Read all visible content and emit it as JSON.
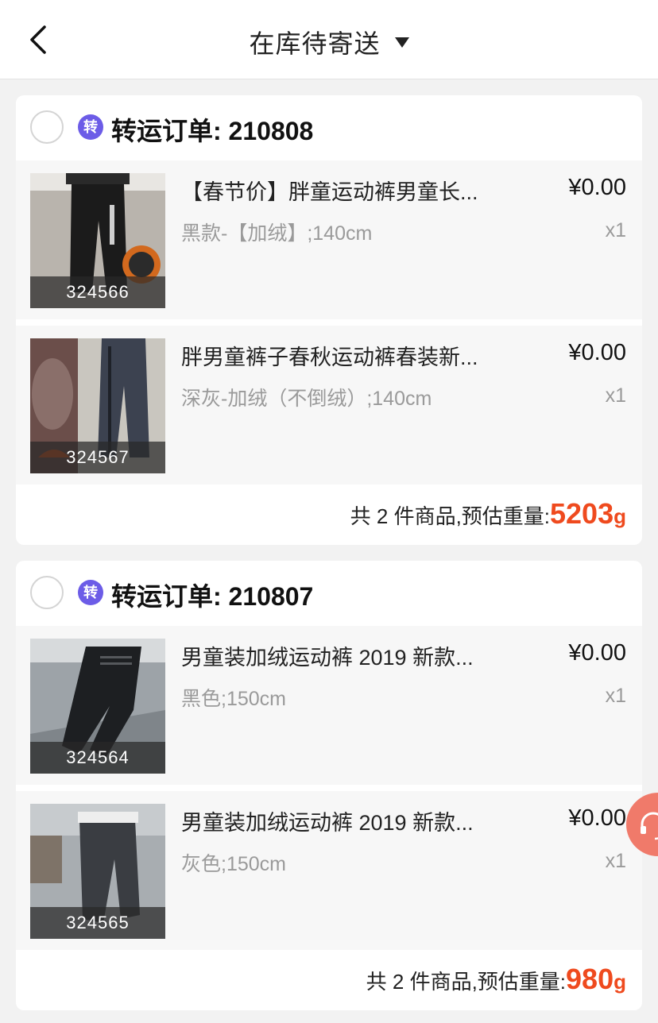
{
  "header": {
    "back_icon": "chevron-left-icon",
    "title": "在库待寄送",
    "title_dropdown_icon": "caret-down-icon"
  },
  "orders": [
    {
      "badge": "转",
      "label": "转运订单: 210808",
      "items": [
        {
          "code": "324566",
          "title": "【春节价】胖童运动裤男童长...",
          "spec": "黑款-【加绒】;140cm",
          "price": "¥0.00",
          "qty": "x1"
        },
        {
          "code": "324567",
          "title": "胖男童裤子春秋运动裤春装新...",
          "spec": "深灰-加绒（不倒绒）;140cm",
          "price": "¥0.00",
          "qty": "x1"
        }
      ],
      "summary_text": "共 2 件商品,预估重量:",
      "weight": "5203",
      "weight_unit": "g"
    },
    {
      "badge": "转",
      "label": "转运订单: 210807",
      "items": [
        {
          "code": "324564",
          "title": "男童装加绒运动裤 2019 新款...",
          "spec": "黑色;150cm",
          "price": "¥0.00",
          "qty": "x1"
        },
        {
          "code": "324565",
          "title": "男童装加绒运动裤 2019 新款...",
          "spec": "灰色;150cm",
          "price": "¥0.00",
          "qty": "x1"
        }
      ],
      "summary_text": "共 2 件商品,预估重量:",
      "weight": "980",
      "weight_unit": "g"
    }
  ],
  "floating_button": {
    "icon": "customer-service-headset-icon"
  },
  "colors": {
    "accent_weight": "#ef4a1e",
    "badge_purple": "#6c5ce7",
    "float_button": "#f07a6a"
  }
}
